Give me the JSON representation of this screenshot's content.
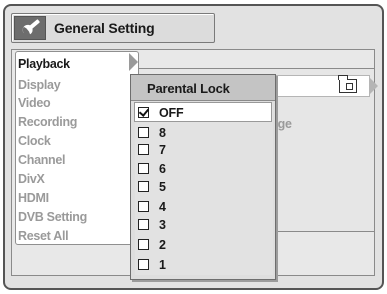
{
  "window": {
    "title": "General Setting",
    "title_icon": "wrench-icon"
  },
  "menu": {
    "items": [
      {
        "label": "Playback",
        "active": true
      },
      {
        "label": "Display",
        "active": false
      },
      {
        "label": "Video",
        "active": false
      },
      {
        "label": "Recording",
        "active": false
      },
      {
        "label": "Clock",
        "active": false
      },
      {
        "label": "Channel",
        "active": false
      },
      {
        "label": "DivX",
        "active": false
      },
      {
        "label": "HDMI",
        "active": false
      },
      {
        "label": "DVB Setting",
        "active": false
      },
      {
        "label": "Reset All",
        "active": false
      }
    ]
  },
  "submenu": {
    "fragments": [
      "age",
      "e"
    ],
    "icon": "folder-lock-icon"
  },
  "popup": {
    "title": "Parental Lock",
    "options": [
      {
        "label": "OFF",
        "checked": true
      },
      {
        "label": "8",
        "checked": false
      },
      {
        "label": "7",
        "checked": false
      },
      {
        "label": "6",
        "checked": false
      },
      {
        "label": "5",
        "checked": false
      },
      {
        "label": "4",
        "checked": false
      },
      {
        "label": "3",
        "checked": false
      },
      {
        "label": "2",
        "checked": false
      },
      {
        "label": "1",
        "checked": false
      }
    ]
  },
  "colors": {
    "frame": "#555555",
    "inactive_text": "#9a9a9a",
    "active_text": "#1a1a1a",
    "highlight": "#ffffff"
  }
}
